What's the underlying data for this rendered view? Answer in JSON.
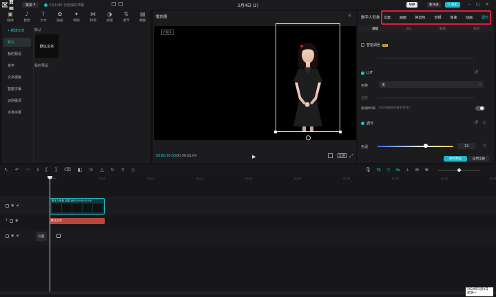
{
  "app": {
    "logo_text": "剪映",
    "menu_label": "菜单",
    "save_status": "2月14日 已经保存草稿",
    "project_title": "2月4日 (2)",
    "vip_label": "VIP",
    "btn_record": "快速",
    "btn_export": "导出"
  },
  "toolbar": {
    "tools": [
      {
        "label": "媒体",
        "icon": "media-icon"
      },
      {
        "label": "音频",
        "icon": "audio-icon"
      },
      {
        "label": "文本",
        "icon": "text-icon"
      },
      {
        "label": "贴纸",
        "icon": "sticker-icon"
      },
      {
        "label": "特效",
        "icon": "effects-icon"
      },
      {
        "label": "转场",
        "icon": "transition-icon"
      },
      {
        "label": "滤镜",
        "icon": "filter-icon"
      },
      {
        "label": "调节",
        "icon": "adjust-icon"
      },
      {
        "label": "模板",
        "icon": "template-icon"
      }
    ]
  },
  "text_panel": {
    "categories": [
      "• 新建文本",
      "默认",
      "花字",
      "文字模板",
      "智能字幕",
      "识别歌词",
      "本地字幕"
    ],
    "cat_add_extra": "我的预设",
    "section_label": "默认",
    "default_card": "默认文本",
    "my_preset": "我的预设"
  },
  "player": {
    "title": "播放器",
    "badge": "片段 1",
    "time_current": "00:00:00:00",
    "time_total": "00:00:01:04",
    "ratio_label": "比例"
  },
  "right_panel": {
    "label": "数字人形象",
    "tabs": [
      "文案",
      "画面",
      "换音色",
      "音频",
      "变速",
      "动画",
      "调节"
    ],
    "subtabs": [
      "基础",
      "HSL",
      "曲线",
      "色轮"
    ],
    "smart_color": "智能调色",
    "smart_badge": "VIP",
    "lut": "LUT",
    "lut_name_label": "名称",
    "lut_name_value": "无",
    "intensity_label": "强度",
    "hdr_label": "启用HDR",
    "hdr_hint": "(HDR视频效果会更佳)",
    "adjust_label": "调节",
    "temp_label": "色温",
    "temp_value": "13",
    "save_preset": "保存预设",
    "apply_all": "应用全部"
  },
  "timeline": {
    "ruler": [
      "00:00",
      "00:05",
      "00:10",
      "00:15",
      "00:20",
      "00:25",
      "00:30",
      "00:35",
      "00:40",
      "00:45"
    ],
    "video_clip_label": "数字人形象  拉镜-对白  00:00:01:04",
    "text_clip_label": "默认文本",
    "cover_label": "封面"
  },
  "taskbar": {
    "date": "2024年2月4日",
    "weekday": "星期一"
  },
  "colors": {
    "accent": "#1fc3d1",
    "highlight_border": "#d8223c",
    "text_clip": "#b5483c",
    "video_clip": "#1e9aa4"
  }
}
